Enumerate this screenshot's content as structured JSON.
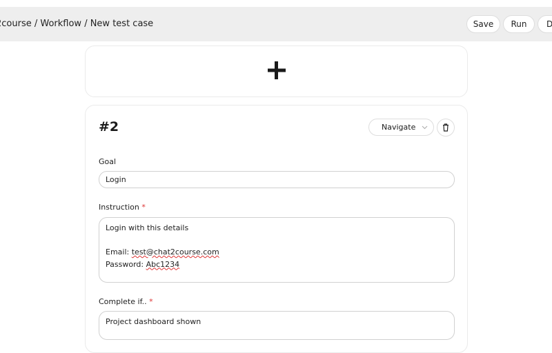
{
  "header": {
    "breadcrumb": "2course / Workflow / New test case",
    "save": "Save",
    "run": "Run",
    "more": "D"
  },
  "add_step": {
    "icon": "plus-icon"
  },
  "step": {
    "number": "#2",
    "action_type": "Navigate",
    "goal_label": "Goal",
    "goal_value": "Login",
    "instruction_label": "Instruction",
    "instruction_line1": "Login with this details",
    "email_prefix": "Email: ",
    "email_value": "test@chat2course.com",
    "password_prefix": "Password: ",
    "password_value": "Abc1234",
    "complete_label": "Complete if..",
    "complete_value": "Project dashboard shown",
    "required_mark": "*"
  }
}
